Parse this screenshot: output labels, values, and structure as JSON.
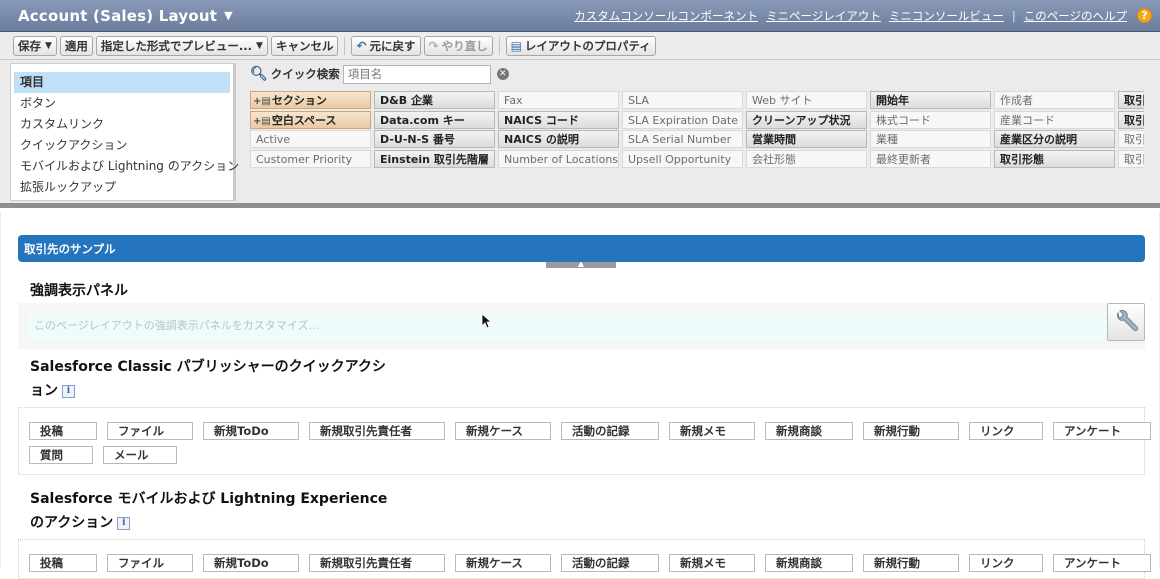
{
  "header": {
    "title": "Account (Sales) Layout",
    "links": [
      "カスタムコンソールコンポーネント",
      "ミニページレイアウト",
      "ミニコンソールビュー"
    ],
    "help_link": "このページのヘルプ",
    "help_icon": "question-icon",
    "background": "#7687a6"
  },
  "toolbar": {
    "save": "保存",
    "apply": "適用",
    "preview": "指定した形式でプレビュー...",
    "cancel": "キャンセル",
    "undo": "元に戻す",
    "redo": "やり直し",
    "properties": "レイアウトのプロパティ"
  },
  "palette": {
    "categories": [
      "項目",
      "ボタン",
      "カスタムリンク",
      "クイックアクション",
      "モバイルおよび Lightning のアクション",
      "拡張ルックアップ"
    ],
    "selected_category": "項目",
    "quick_find_label": "クイック検索",
    "quick_find_placeholder": "項目名",
    "rows": [
      [
        "セクション",
        "D&B 企業",
        "Fax",
        "SLA",
        "Web サイト",
        "開始年",
        "作成者",
        "取引"
      ],
      [
        "空白スペース",
        "Data.com キー",
        "NAICS コード",
        "SLA Expiration Date",
        "クリーンアップ状況",
        "株式コード",
        "産業コード",
        "取引"
      ],
      [
        "Active",
        "D-U-N-S 番号",
        "NAICS の説明",
        "SLA Serial Number",
        "営業時間",
        "業種",
        "産業区分の説明",
        "取引"
      ],
      [
        "Customer Priority",
        "Einstein 取引先階層",
        "Number of Locations",
        "Upsell Opportunity",
        "会社形態",
        "最終更新者",
        "取引形態",
        "取引"
      ]
    ],
    "bold_cells": [
      [
        0,
        1
      ],
      [
        0,
        5
      ],
      [
        0,
        7
      ],
      [
        1,
        1
      ],
      [
        1,
        2
      ],
      [
        1,
        4
      ],
      [
        1,
        7
      ],
      [
        2,
        1
      ],
      [
        2,
        2
      ],
      [
        2,
        4
      ],
      [
        2,
        6
      ],
      [
        3,
        1
      ],
      [
        3,
        6
      ]
    ],
    "special_cells": [
      [
        0,
        0
      ],
      [
        1,
        0
      ]
    ]
  },
  "main": {
    "section_title": "取引先のサンプル",
    "highlights_heading": "強調表示パネル",
    "highlights_placeholder": "このページレイアウトの強調表示パネルをカスタマイズ...",
    "classic_heading_line1": "Salesforce Classic パブリッシャーのクイックアクシ",
    "classic_heading_line2": "ョン",
    "mobile_heading_line1": "Salesforce モバイルおよび Lightning Experience",
    "mobile_heading_line2": "のアクション",
    "classic_actions": [
      "投稿",
      "ファイル",
      "新規ToDo",
      "新規取引先責任者",
      "新規ケース",
      "活動の記録",
      "新規メモ",
      "新規商談",
      "新規行動",
      "リンク",
      "アンケート",
      "質問",
      "メール"
    ],
    "mobile_actions": [
      "投稿",
      "ファイル",
      "新規ToDo",
      "新規取引先責任者",
      "新規ケース",
      "活動の記録",
      "新規メモ",
      "新規商談",
      "新規行動",
      "リンク",
      "アンケート"
    ],
    "accent": "#2574be"
  }
}
